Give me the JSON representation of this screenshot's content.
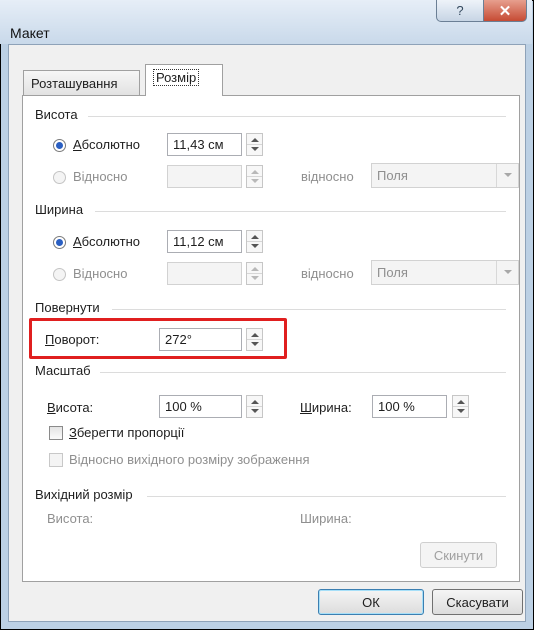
{
  "window": {
    "title": "Макет",
    "help_glyph": "?",
    "close_glyph": "✕"
  },
  "tabs": [
    {
      "label": "Розташування",
      "selected": false
    },
    {
      "label": "Розмір",
      "selected": true
    }
  ],
  "height_group": {
    "title": "Висота",
    "absolute_label_first": "А",
    "absolute_label_rest": "бсолютно",
    "absolute_value": "11,43 см",
    "relative_label": "Відносно",
    "relative_value": "",
    "relative_to_label": "відносно",
    "relative_to_value": "Поля"
  },
  "width_group": {
    "title": "Ширина",
    "absolute_label_first": "А",
    "absolute_label_rest": "бсолютно",
    "absolute_value": "11,12 см",
    "relative_label": "Відносно",
    "relative_value": "",
    "relative_to_label": "відносно",
    "relative_to_value": "Поля"
  },
  "rotate_group": {
    "title": "Повернути",
    "rotation_label_first": "П",
    "rotation_label_rest": "оворот:",
    "rotation_value": "272°"
  },
  "scale_group": {
    "title": "Масштаб",
    "height_label_first": "В",
    "height_label_rest": "исота:",
    "height_value": "100 %",
    "width_label_first": "Ш",
    "width_label_rest": "ирина:",
    "width_value": "100 %",
    "lock_aspect_first": "З",
    "lock_aspect_rest": "берегти пропорції",
    "lock_aspect_checked": false,
    "relative_original_label": "Відносно вихідного розміру зображення",
    "relative_original_checked": false
  },
  "original_size_group": {
    "title": "Вихідний розмір",
    "height_label": "Висота:",
    "width_label": "Ширина:",
    "reset_label": "Скинути"
  },
  "buttons": {
    "ok": "ОК",
    "cancel": "Скасувати"
  }
}
